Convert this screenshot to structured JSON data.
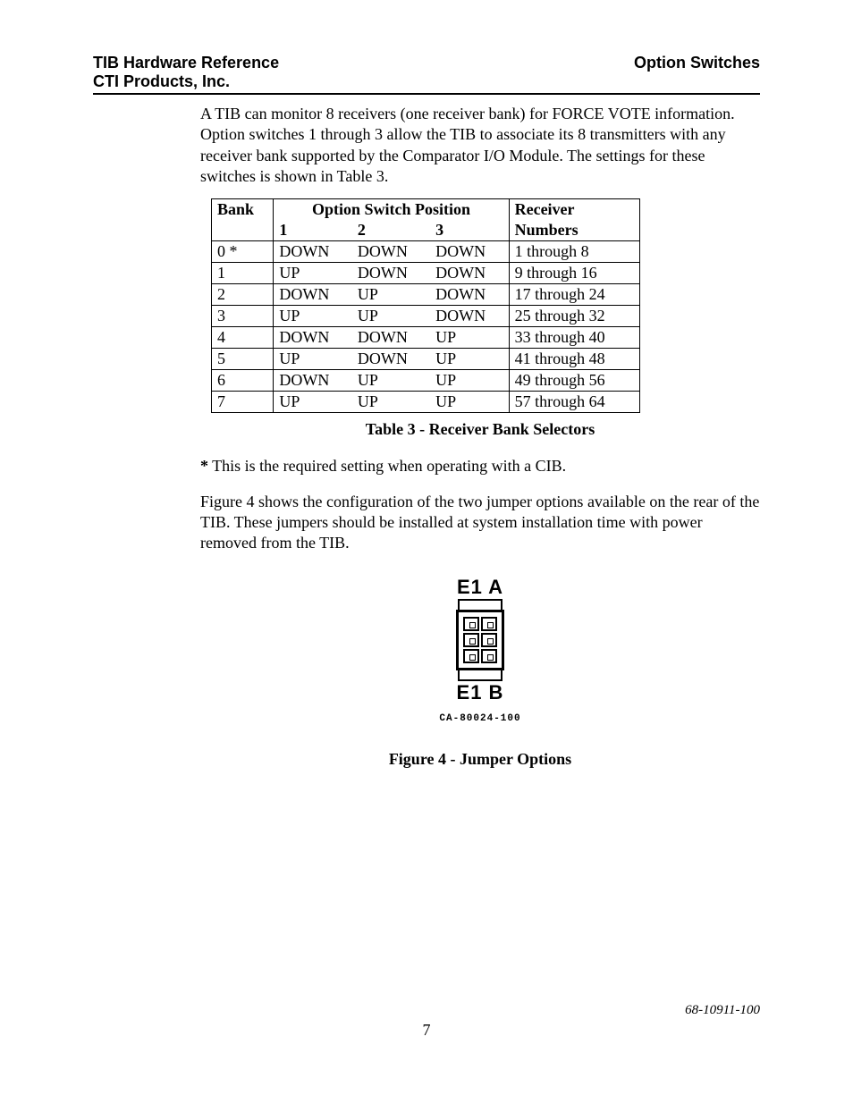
{
  "header": {
    "left1": "TIB Hardware Reference",
    "right1": "Option Switches",
    "left2": "CTI Products, Inc."
  },
  "paragraphs": {
    "p1": "A TIB can monitor 8 receivers (one receiver bank) for FORCE VOTE information.  Option switches 1 through 3  allow the TIB to associate its 8 transmitters with any  receiver bank supported by the Comparator I/O Module.  The settings for these switches is shown in Table 3.",
    "footnote_star": "*",
    "footnote": "  This is the required setting when operating with a CIB.",
    "p2": "Figure 4 shows the configuration of the two jumper options available on the rear of the TIB.  These jumpers should be installed at system installation time with power removed from the TIB."
  },
  "table": {
    "col_bank": "Bank",
    "col_switch": "Option Switch Position",
    "col_receiver": "Receiver",
    "sub_1": "1",
    "sub_2": "2",
    "sub_3": "3",
    "sub_numbers": "Numbers",
    "rows": [
      {
        "bank": "0 *",
        "s1": "DOWN",
        "s2": "DOWN",
        "s3": "DOWN",
        "rcv": "1 through 8"
      },
      {
        "bank": "1",
        "s1": "UP",
        "s2": "DOWN",
        "s3": "DOWN",
        "rcv": "9 through 16"
      },
      {
        "bank": "2",
        "s1": "DOWN",
        "s2": "UP",
        "s3": "DOWN",
        "rcv": "17 through 24"
      },
      {
        "bank": "3",
        "s1": "UP",
        "s2": "UP",
        "s3": "DOWN",
        "rcv": "25 through 32"
      },
      {
        "bank": "4",
        "s1": "DOWN",
        "s2": "DOWN",
        "s3": "UP",
        "rcv": "33 through 40"
      },
      {
        "bank": "5",
        "s1": "UP",
        "s2": "DOWN",
        "s3": "UP",
        "rcv": "41 through 48"
      },
      {
        "bank": "6",
        "s1": "DOWN",
        "s2": "UP",
        "s3": "UP",
        "rcv": "49 through 56"
      },
      {
        "bank": "7",
        "s1": "UP",
        "s2": "UP",
        "s3": "UP",
        "rcv": "57 through 64"
      }
    ],
    "caption": "Table 3 - Receiver Bank Selectors"
  },
  "figure": {
    "label_top": "E1 A",
    "label_bottom": "E1 B",
    "partno": "CA-80024-100",
    "caption": "Figure 4 - Jumper Options"
  },
  "footer": {
    "docnum": "68-10911-100",
    "pagenum": "7"
  }
}
